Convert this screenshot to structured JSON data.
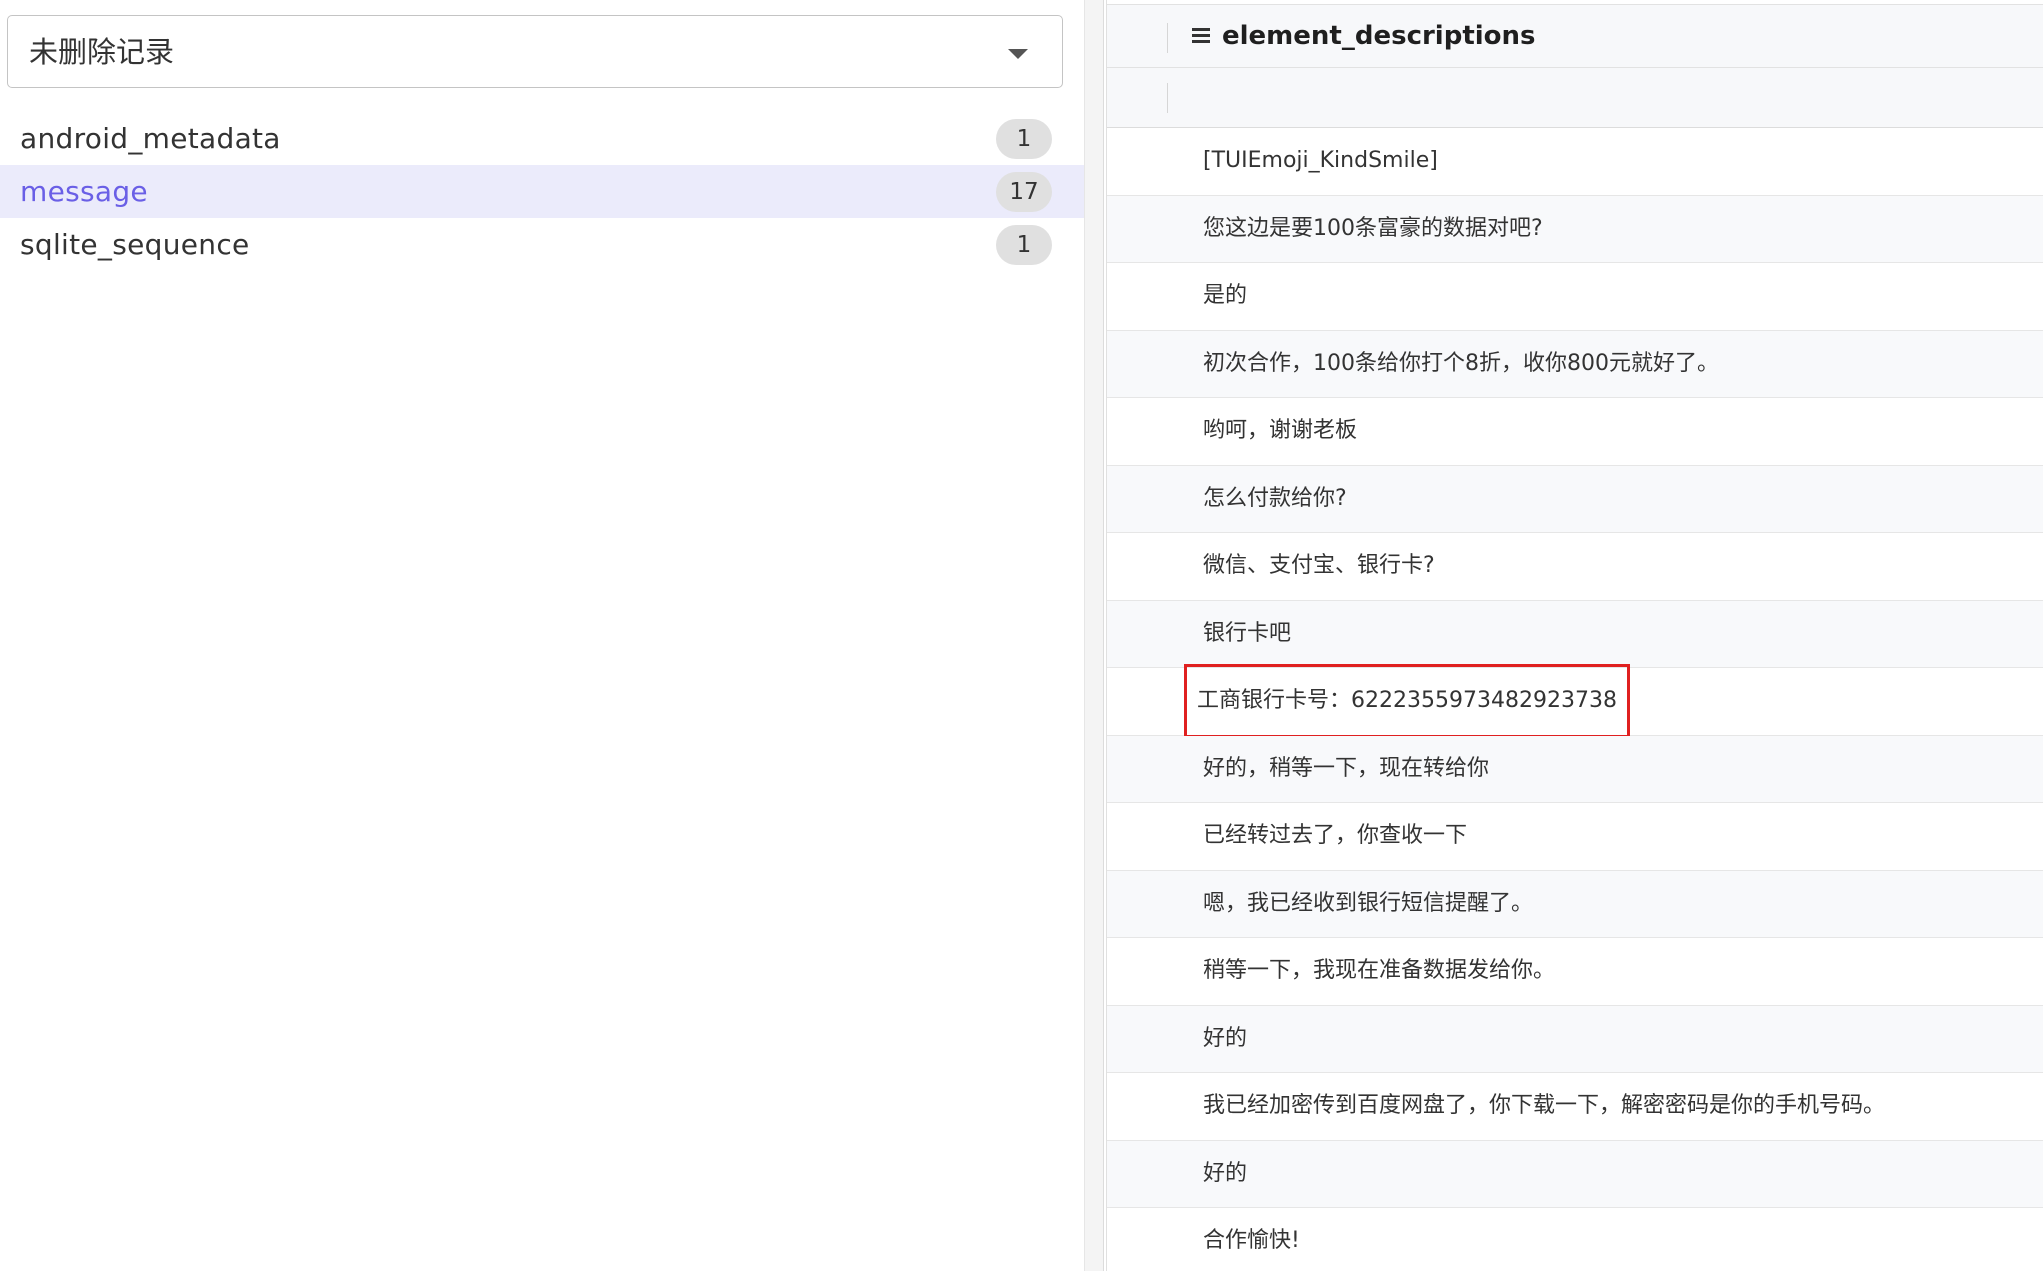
{
  "left_panel": {
    "select": {
      "value": "未删除记录"
    },
    "tables": [
      {
        "label": "android_metadata",
        "count": "1",
        "selected": false
      },
      {
        "label": "message",
        "count": "17",
        "selected": true
      },
      {
        "label": "sqlite_sequence",
        "count": "1",
        "selected": false
      }
    ]
  },
  "grid": {
    "column_title": "element_descriptions",
    "rows": [
      "[TUIEmoji_KindSmile]",
      "您这边是要100条富豪的数据对吧?",
      "是的",
      "初次合作，100条给你打个8折，收你800元就好了。",
      "哟呵，谢谢老板",
      "怎么付款给你?",
      "微信、支付宝、银行卡?",
      "银行卡吧",
      "工商银行卡号：6222355973482923738",
      "好的，稍等一下，现在转给你",
      "已经转过去了，你查收一下",
      "嗯，我已经收到银行短信提醒了。",
      "稍等一下，我现在准备数据发给你。",
      "好的",
      "我已经加密传到百度网盘了，你下载一下，解密密码是你的手机号码。",
      "好的",
      "合作愉快!"
    ],
    "highlighted_row_index": 8
  },
  "colors": {
    "accent": "#6a5fe6",
    "selected_bg": "#ebebfb",
    "highlight_border": "#e02020"
  },
  "icons": {
    "select_caret": "caret-down-icon",
    "column_icon": "list-icon"
  }
}
